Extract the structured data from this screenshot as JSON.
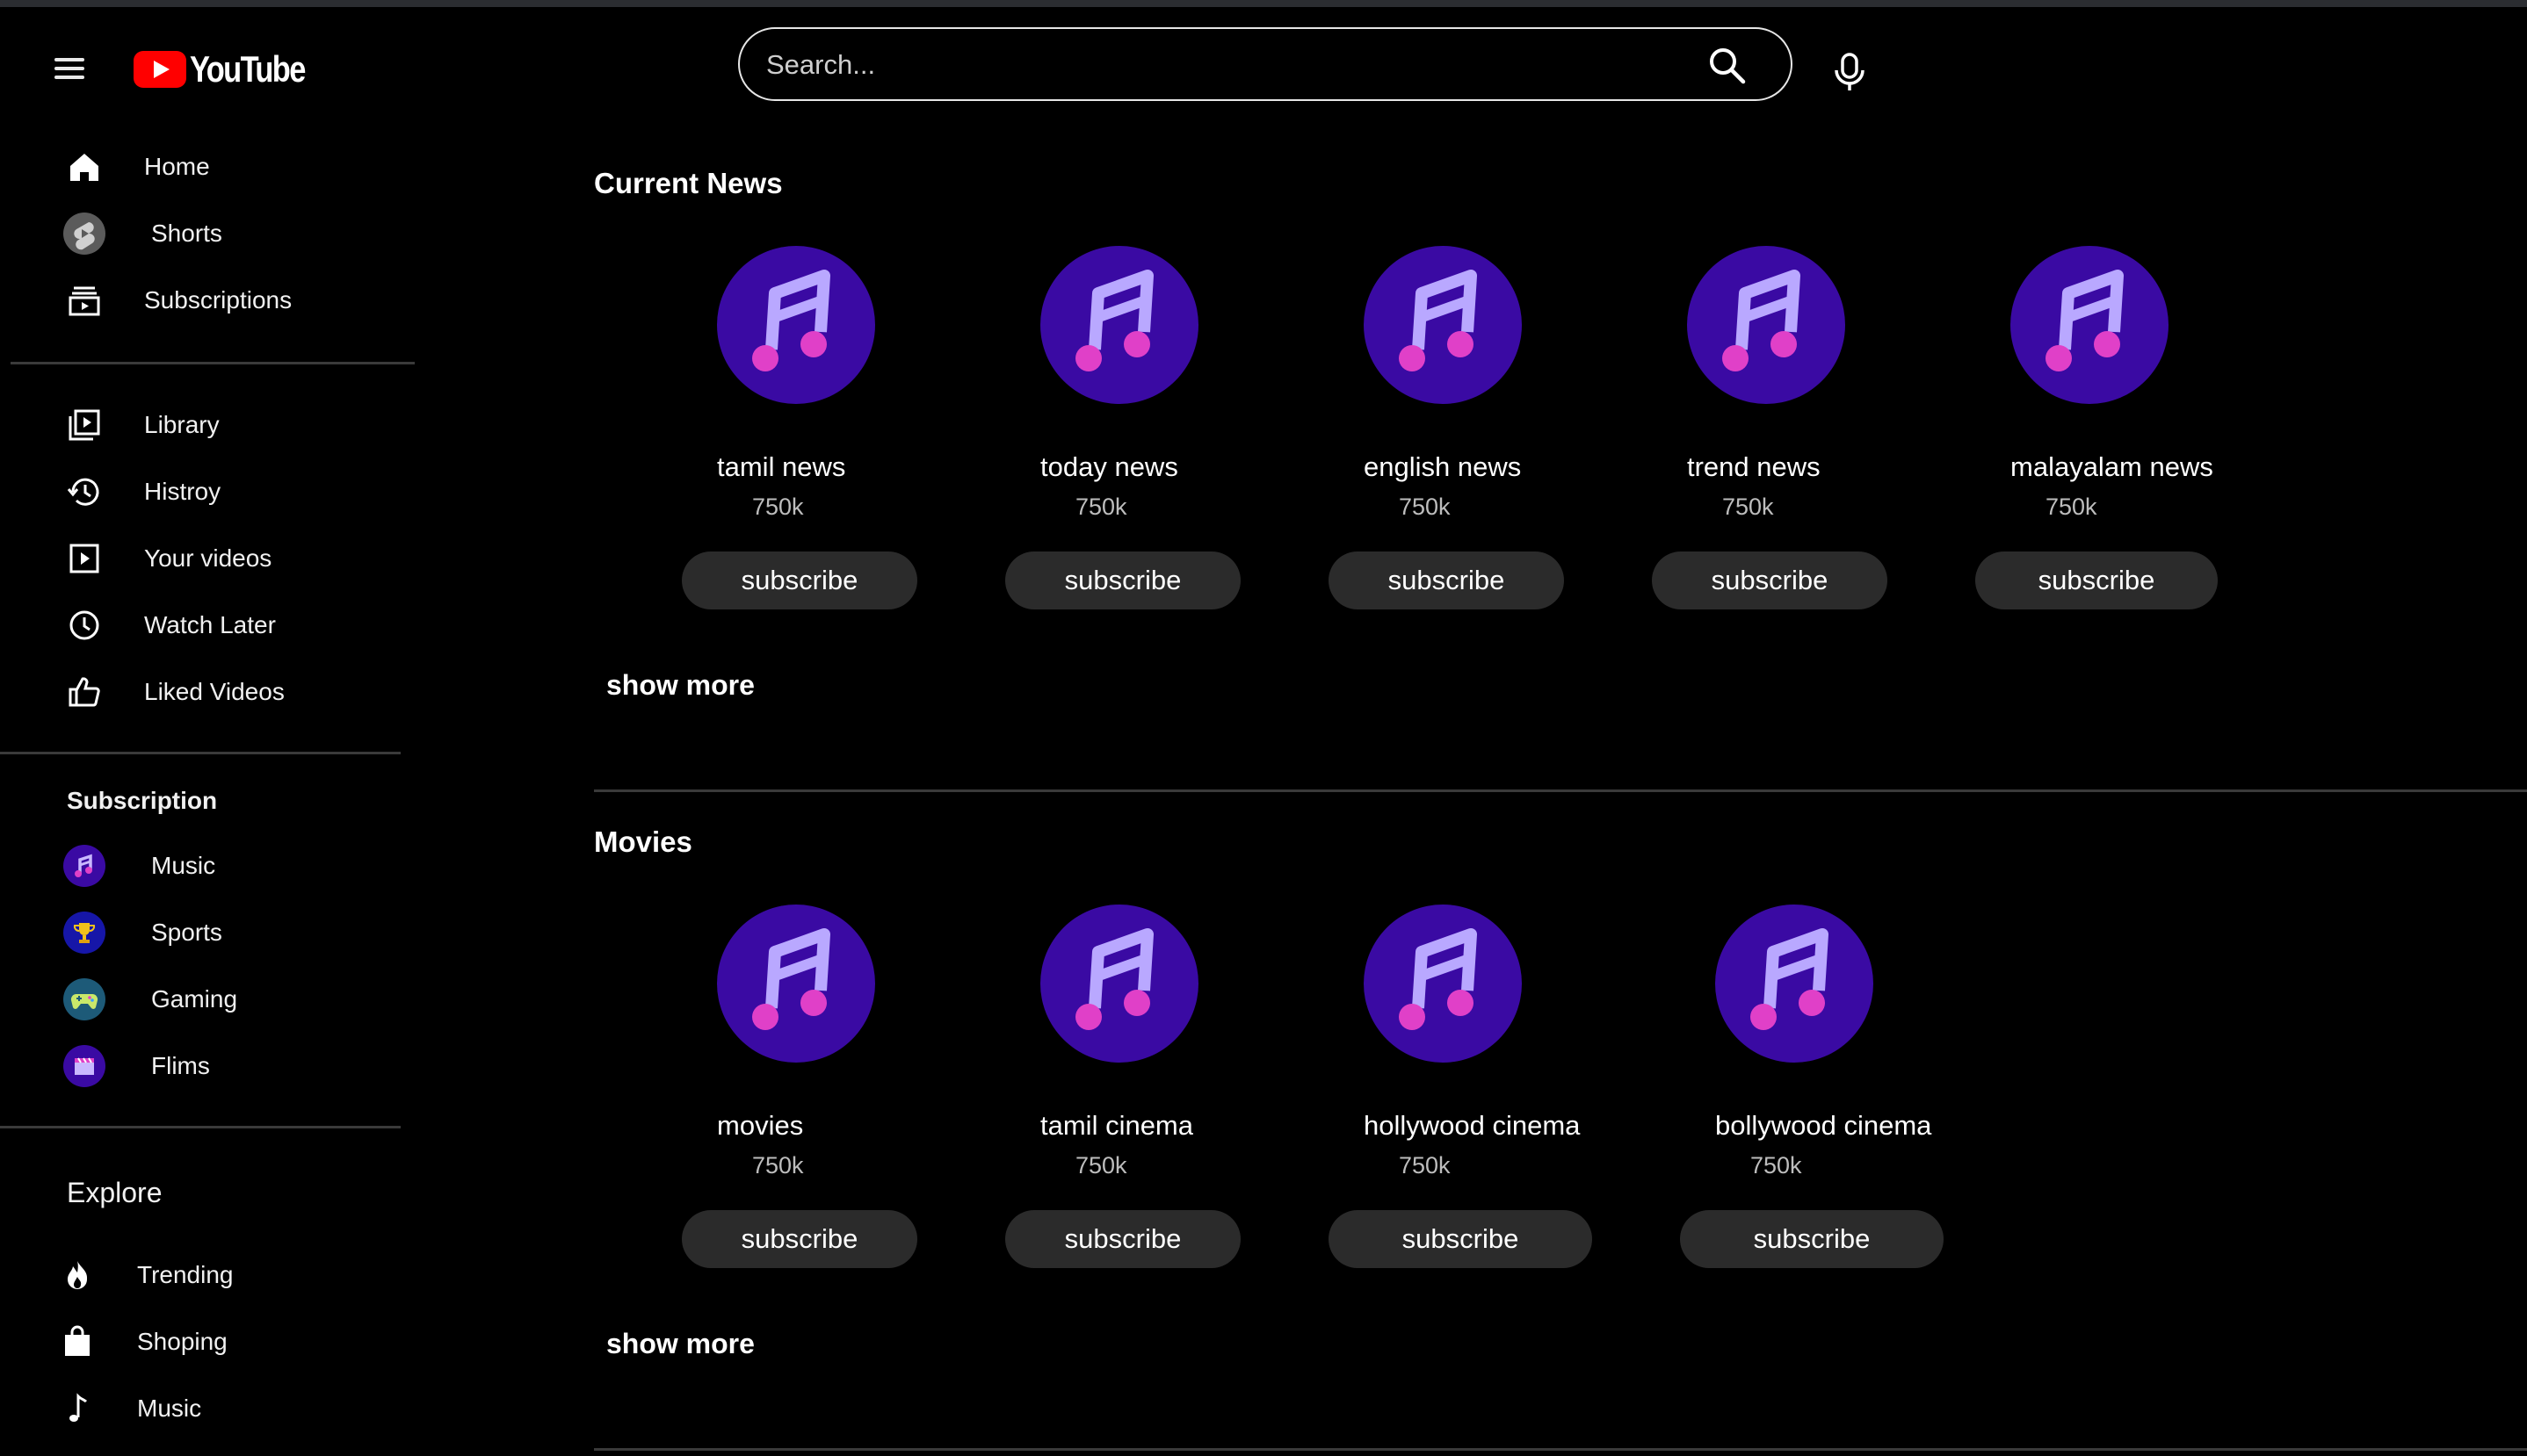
{
  "header": {
    "logo_text": "YouTube",
    "search_placeholder": "Search..."
  },
  "sidebar": {
    "main": [
      {
        "label": "Home",
        "icon": "home-icon"
      },
      {
        "label": "Shorts",
        "icon": "shorts-icon"
      },
      {
        "label": "Subscriptions",
        "icon": "subscriptions-icon"
      }
    ],
    "library": [
      {
        "label": "Library",
        "icon": "library-icon"
      },
      {
        "label": "Histroy",
        "icon": "history-icon"
      },
      {
        "label": "Your videos",
        "icon": "your-videos-icon"
      },
      {
        "label": "Watch Later",
        "icon": "clock-icon"
      },
      {
        "label": "Liked Videos",
        "icon": "thumbs-up-icon"
      }
    ],
    "subscription_heading": "Subscription",
    "subscriptions": [
      {
        "label": "Music",
        "icon": "music-note-icon"
      },
      {
        "label": "Sports",
        "icon": "trophy-icon"
      },
      {
        "label": "Gaming",
        "icon": "gamepad-icon"
      },
      {
        "label": "Flims",
        "icon": "clapperboard-icon"
      }
    ],
    "explore_heading": "Explore",
    "explore": [
      {
        "label": "Trending",
        "icon": "flame-icon"
      },
      {
        "label": "Shoping",
        "icon": "shopping-bag-icon"
      },
      {
        "label": "Music",
        "icon": "music-note-icon"
      }
    ]
  },
  "sections": [
    {
      "title": "Current News",
      "channels": [
        {
          "name": "tamil news",
          "subscribers": "750k",
          "button": "subscribe"
        },
        {
          "name": "today news",
          "subscribers": "750k",
          "button": "subscribe"
        },
        {
          "name": "english news",
          "subscribers": "750k",
          "button": "subscribe"
        },
        {
          "name": "trend news",
          "subscribers": "750k",
          "button": "subscribe"
        },
        {
          "name": "malayalam news",
          "subscribers": "750k",
          "button": "subscribe"
        }
      ],
      "show_more": "show more"
    },
    {
      "title": "Movies",
      "channels": [
        {
          "name": "movies",
          "subscribers": "750k",
          "button": "subscribe"
        },
        {
          "name": "tamil cinema",
          "subscribers": "750k",
          "button": "subscribe"
        },
        {
          "name": "hollywood cinema",
          "subscribers": "750k",
          "button": "subscribe"
        },
        {
          "name": "bollywood cinema",
          "subscribers": "750k",
          "button": "subscribe"
        }
      ],
      "show_more": "show more"
    }
  ],
  "colors": {
    "background": "#000000",
    "brand_red": "#ff0000",
    "avatar_purple": "#3a0aa3",
    "note_light": "#b9a8ff",
    "note_pink": "#e040c8",
    "button_bg": "#2b2b2b"
  }
}
